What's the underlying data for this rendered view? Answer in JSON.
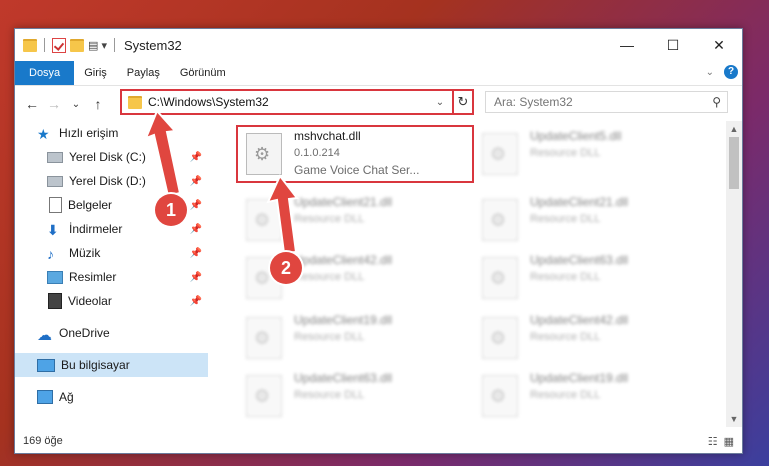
{
  "window": {
    "title": "System32",
    "controls": {
      "minimize": "—",
      "maximize": "☐",
      "close": "✕"
    }
  },
  "ribbon": {
    "tabs": [
      {
        "label": "Dosya",
        "active": true
      },
      {
        "label": "Giriş",
        "active": false
      },
      {
        "label": "Paylaş",
        "active": false
      },
      {
        "label": "Görünüm",
        "active": false
      }
    ],
    "expand_icon": "chevron-down-icon",
    "help_label": "?"
  },
  "nav": {
    "back": "←",
    "forward": "→",
    "recent": "⌄",
    "up": "↑",
    "address": "C:\\Windows\\System32",
    "refresh": "↻",
    "search_placeholder": "Ara: System32"
  },
  "sidebar": {
    "items": [
      {
        "label": "Hızlı erişim",
        "icon": "star-icon",
        "pinned": false
      },
      {
        "label": "Yerel Disk (C:)",
        "icon": "drive-icon",
        "pinned": true
      },
      {
        "label": "Yerel Disk (D:)",
        "icon": "drive-icon",
        "pinned": true
      },
      {
        "label": "Belgeler",
        "icon": "documents-icon",
        "pinned": true
      },
      {
        "label": "İndirmeler",
        "icon": "downloads-icon",
        "pinned": true
      },
      {
        "label": "Müzik",
        "icon": "music-icon",
        "pinned": true
      },
      {
        "label": "Resimler",
        "icon": "pictures-icon",
        "pinned": true
      },
      {
        "label": "Videolar",
        "icon": "videos-icon",
        "pinned": true
      },
      {
        "label": "OneDrive",
        "icon": "cloud-icon",
        "pinned": false
      },
      {
        "label": "Bu bilgisayar",
        "icon": "computer-icon",
        "pinned": false,
        "selected": true
      },
      {
        "label": "Ağ",
        "icon": "network-icon",
        "pinned": false
      }
    ]
  },
  "files": {
    "highlighted": {
      "name": "mshvchat.dll",
      "version": "0.1.0.214",
      "description": "Game Voice Chat Ser..."
    },
    "blurred": [
      {
        "name": "UpdateClient5.dll",
        "description": "Resource DLL"
      },
      {
        "name": "UpdateClient21.dll",
        "description": "Resource DLL"
      },
      {
        "name": "UpdateClient21.dll",
        "description": "Resource DLL"
      },
      {
        "name": "UpdateClient42.dll",
        "description": "Resource DLL"
      },
      {
        "name": "UpdateClient63.dll",
        "description": "Resource DLL"
      },
      {
        "name": "UpdateClient19.dll",
        "description": "Resource DLL"
      },
      {
        "name": "UpdateClient42.dll",
        "description": "Resource DLL"
      },
      {
        "name": "UpdateClient63.dll",
        "description": "Resource DLL"
      },
      {
        "name": "UpdateClient19.dll",
        "description": "Resource DLL"
      }
    ]
  },
  "status": {
    "count": "169 öğe"
  },
  "annotations": {
    "step1": "1",
    "step2": "2",
    "color": "#e0463f"
  }
}
